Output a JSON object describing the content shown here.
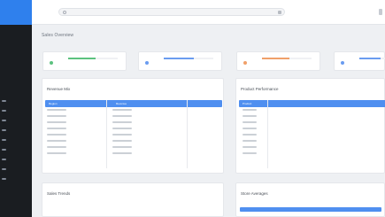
{
  "colors": {
    "accent": "#2f80ed",
    "sidebar_bg": "#1a1d21",
    "table_header": "#4f8ff0",
    "kpi_green": "#5cc27f",
    "kpi_blue": "#6a9cf0",
    "kpi_orange": "#f0a06a",
    "kpi_blue_2": "#6a9cf0"
  },
  "search": {
    "placeholder": ""
  },
  "overview": {
    "title": "Sales Overview"
  },
  "kpis": [
    {
      "value": "",
      "icon": "chart-icon",
      "color": "#5cc27f",
      "progress": 0.55
    },
    {
      "value": "",
      "icon": "cart-icon",
      "color": "#6a9cf0",
      "progress": 0.6
    },
    {
      "value": "",
      "icon": "money-icon",
      "color": "#f0a06a",
      "progress": 0.55
    },
    {
      "value": "",
      "icon": "user-icon",
      "color": "#6a9cf0",
      "progress": 0.6
    }
  ],
  "left_panel": {
    "title": "Revenue Mix",
    "columns": [
      "Region",
      "Revenue",
      ""
    ]
  },
  "right_panel": {
    "title": "Product Performance",
    "columns": [
      "Product",
      "",
      ""
    ]
  },
  "lower_left": {
    "title": "Sales Trends"
  },
  "lower_right": {
    "title": "Store Averages"
  }
}
